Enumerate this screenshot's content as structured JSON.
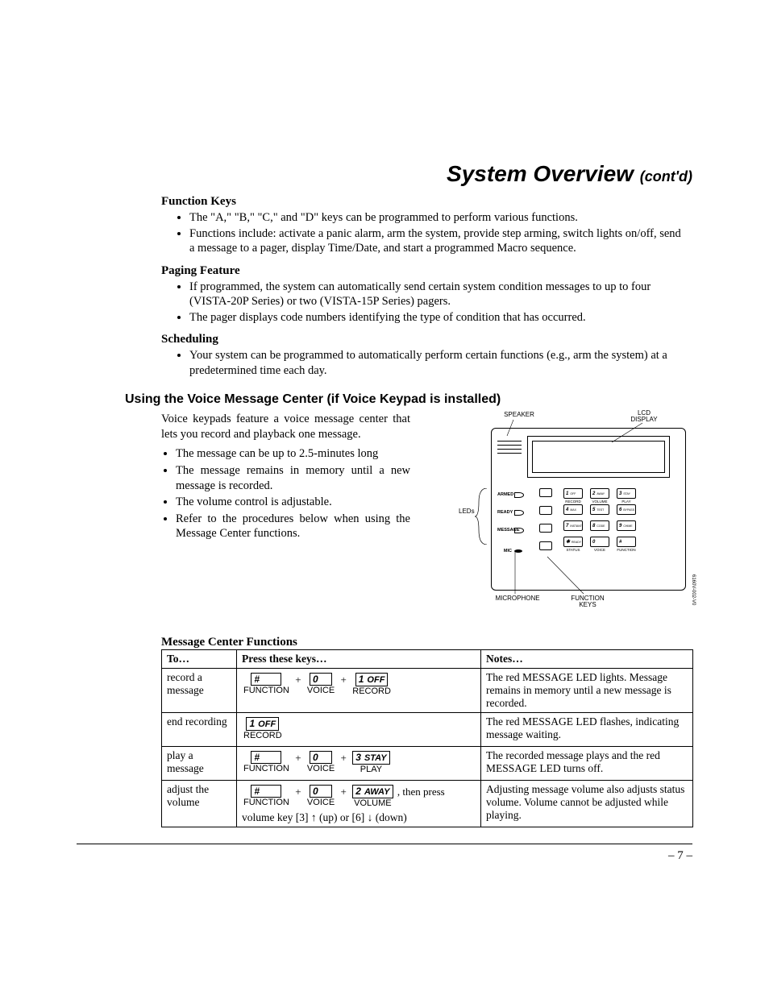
{
  "title_main": "System Overview",
  "title_cont": "(cont'd)",
  "sections": {
    "function_keys": {
      "heading": "Function Keys",
      "b1": "The \"A,\" \"B,\" \"C,\" and \"D\" keys can be programmed to perform various functions.",
      "b2": "Functions include: activate a panic alarm, arm the system, provide step arming, switch lights on/off, send a message to a pager, display Time/Date, and start a programmed Macro sequence."
    },
    "paging": {
      "heading": "Paging Feature",
      "b1": "If programmed, the system can automatically send certain system condition messages to up to four (VISTA-20P Series) or two (VISTA-15P Series) pagers.",
      "b2": "The pager displays code numbers identifying the type of condition that has occurred."
    },
    "scheduling": {
      "heading": "Scheduling",
      "b1": "Your system can be programmed to automatically perform certain functions (e.g., arm the system) at a predetermined time each day."
    }
  },
  "voice_heading": "Using the Voice Message Center (if Voice Keypad is installed)",
  "voice_intro": "Voice keypads feature a voice message center that lets you record and playback one message.",
  "voice_bullets": {
    "b1": "The message can be up to 2.5-minutes long",
    "b2": "The message remains in memory until a new message is recorded.",
    "b3": "The volume control is adjustable.",
    "b4": "Refer to the procedures below when using the Message Center functions."
  },
  "diagram": {
    "speaker": "SPEAKER",
    "lcd": "LCD DISPLAY",
    "leds": "LEDs",
    "armed": "ARMED",
    "ready": "READY",
    "message": "MESSAGE",
    "mic_label": "MIC",
    "microphone": "MICROPHONE",
    "function_keys": "FUNCTION KEYS",
    "sublabels": {
      "record": "RECORD",
      "volume": "VOLUME",
      "play": "PLAY",
      "status": "STATUS",
      "voice": "VOICE",
      "function": "FUNCTION"
    },
    "keys": {
      "k1": "1",
      "k1s": "OFF",
      "k2": "2",
      "k2s": "AWAY",
      "k3": "3",
      "k3s": "STAY",
      "k4": "4",
      "k4s": "MAX",
      "k5": "5",
      "k5s": "TEST",
      "k6": "6",
      "k6s": "BYPASS",
      "k7": "7",
      "k7s": "INSTANT",
      "k8": "8",
      "k8s": "CODE",
      "k9": "9",
      "k9s": "CHIME",
      "kstar": "✱",
      "kstars": "READY",
      "k0": "0",
      "khash": "#"
    },
    "side_code": "6160V-002-V0"
  },
  "table": {
    "title": "Message Center Functions",
    "h1": "To…",
    "h2": "Press these keys…",
    "h3": "Notes…",
    "r1": {
      "to": "record a message",
      "under_function": "FUNCTION",
      "under_voice": "VOICE",
      "under_record": "RECORD",
      "notes": "The red MESSAGE LED lights. Message remains in memory until a new message is recorded."
    },
    "r2": {
      "to": "end recording",
      "under_record": "RECORD",
      "notes": "The red MESSAGE LED flashes, indicating message waiting."
    },
    "r3": {
      "to": "play a message",
      "under_function": "FUNCTION",
      "under_voice": "VOICE",
      "under_play": "PLAY",
      "notes": "The recorded message plays and the red MESSAGE LED turns off."
    },
    "r4": {
      "to": "adjust the volume",
      "under_function": "FUNCTION",
      "under_voice": "VOICE",
      "under_volume": "VOLUME",
      "then": ", then press",
      "extra": "volume key [3] ↑ (up) or [6] ↓ (down)",
      "notes": "Adjusting message volume also adjusts status volume. Volume cannot be adjusted while playing."
    },
    "keycaps": {
      "hash": "#",
      "zero": "0",
      "one_off_n": "1",
      "one_off_s": "OFF",
      "three_stay_n": "3",
      "three_stay_s": "STAY",
      "two_away_n": "2",
      "two_away_s": "AWAY"
    }
  },
  "page_number": "– 7 –"
}
